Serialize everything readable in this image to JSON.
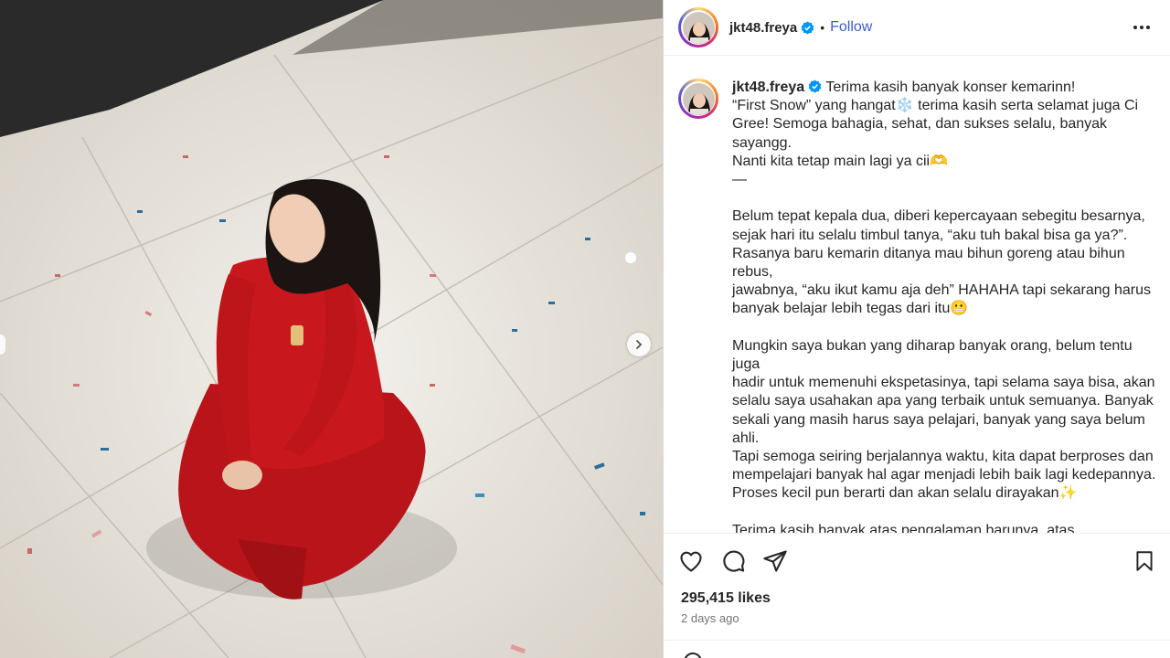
{
  "post": {
    "username": "jkt48.freya",
    "separator": "•",
    "follow_label": "Follow",
    "caption": " Terima kasih banyak konser kemarinn!\n“First Snow” yang hangat❄️ terima kasih serta selamat juga Ci\nGree! Semoga bahagia, sehat, dan sukses selalu, banyak sayangg.\nNanti kita tetap main lagi ya cii🫶\n—\n\nBelum tepat kepala dua, diberi kepercayaan sebegitu besarnya,\nsejak hari itu selalu timbul tanya, “aku tuh bakal bisa ga ya?”.\nRasanya baru kemarin ditanya mau bihun goreng atau bihun rebus,\njawabnya, “aku ikut kamu aja deh” HAHAHA tapi sekarang harus\nbanyak belajar lebih tegas dari itu😬\n\nMungkin saya bukan yang diharap banyak orang, belum tentu juga\nhadir untuk memenuhi ekspetasinya, tapi selama saya bisa, akan\nselalu saya usahakan apa yang terbaik untuk semuanya. Banyak\nsekali yang masih harus saya pelajari, banyak yang saya belum ahli.\nTapi semoga seiring berjalannya waktu, kita dapat berproses dan\nmempelajari banyak hal agar menjadi lebih baik lagi kedepannya.\nProses kecil pun berarti dan akan selalu dirayakan✨\n\nTerima kasih banyak atas pengalaman barunya, atas\nkepercayaannya. Rasanya akan terasa sulit kalau bukan karena\nkeluarga saya, kalau tidak dibantu teman-teman saya, kalau tidak\ndibantu kakak-kakak staff, kalau tidak dibantu kalian. Butuh banyak\nsekali kerja sama dan rasa percaya satu sama lain untuk memikul",
    "likes": "295,415 likes",
    "time_ago": "2 days ago"
  },
  "icons": {
    "verified": "verified-badge-icon",
    "more": "more-options-icon",
    "like": "heart-icon",
    "comment": "comment-icon",
    "share": "share-icon",
    "save": "bookmark-icon",
    "next": "chevron-right-icon"
  },
  "colors": {
    "follow": "#3b5bdb",
    "verified": "#0095f6",
    "dress": "#c0161b"
  }
}
